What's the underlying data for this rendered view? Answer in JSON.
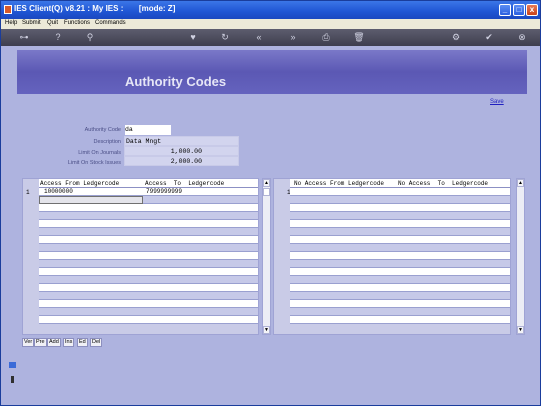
{
  "window": {
    "title": "IES Client(Q) v8.21 : My IES :       [mode: Z]",
    "minimize": "_",
    "maximize": "□",
    "close": "x"
  },
  "menu": {
    "items": [
      "Help",
      "Submit",
      "Quit",
      "Functions",
      "Commands"
    ]
  },
  "toolbar": {
    "icons": [
      "key-icon",
      "help-icon",
      "search-icon",
      "heart-icon",
      "refresh-icon",
      "rewind-icon",
      "forward-icon",
      "bookmark-icon",
      "trash-icon",
      "print-icon",
      "check-icon",
      "close-icon"
    ],
    "glyphs": [
      "⊶",
      "?",
      "⚲",
      "♥",
      "↻",
      "«",
      "»",
      "⎙",
      "🗑",
      "⚙",
      "✔",
      "⊗"
    ]
  },
  "page": {
    "title": "Authority Codes",
    "save_label": "Save"
  },
  "form": {
    "authority_code_label": "Authority Code",
    "authority_code_value": "da",
    "description_label": "Description",
    "description_value": "Data Mngt",
    "limit_journals_label": "Limit On Journals",
    "limit_journals_value": "1,000.00",
    "limit_stock_label": "Limit On Stock Issues",
    "limit_stock_value": "2,000.00"
  },
  "left_grid": {
    "col1": "Access From Ledgercode",
    "col2": "Access  To  Ledgercode",
    "row_number": "1",
    "row1_from": "10000000",
    "row1_to": "7999999999"
  },
  "right_grid": {
    "col1": "No Access From Ledgercode",
    "col2": "No Access  To  Ledgercode",
    "row_number": "1"
  },
  "grid_buttons": [
    "Ver",
    "Pre",
    "Add",
    "Ins",
    "Ed",
    "Del"
  ]
}
